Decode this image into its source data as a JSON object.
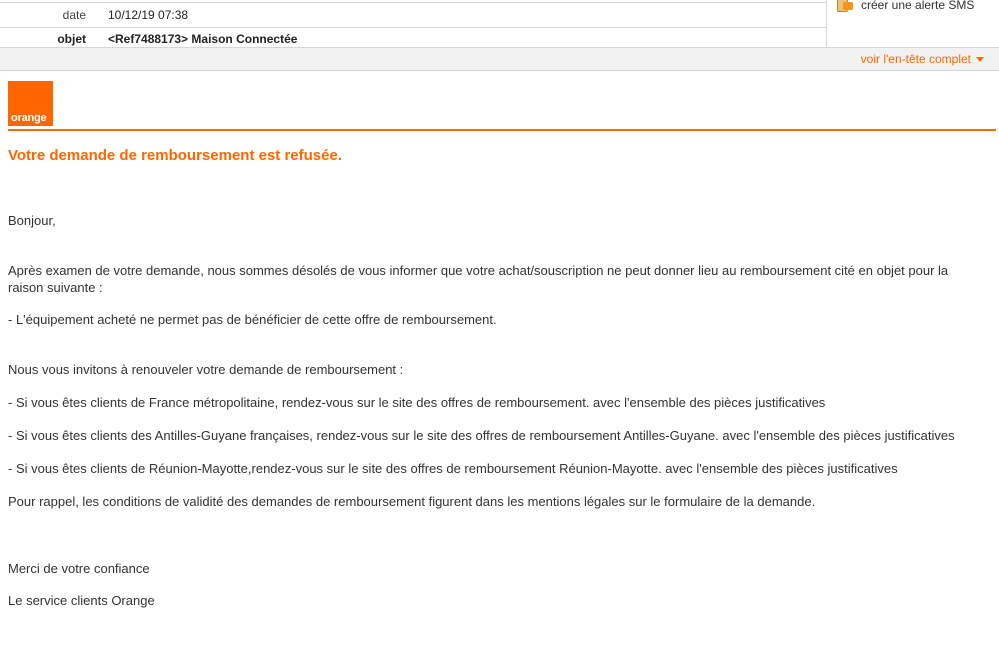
{
  "header": {
    "date_label": "date",
    "date_value": "10/12/19 07:38",
    "subject_label": "objet",
    "subject_value": "<Ref7488173> Maison Connectée",
    "sms_alert": "créer une alerte SMS",
    "full_header_link": "voir l'en-tête complet"
  },
  "brand": {
    "logo_text": "orange",
    "accent_color": "#ff6600"
  },
  "email": {
    "title": "Votre demande de remboursement est refusée.",
    "greeting": "Bonjour,",
    "para1": "Après examen de votre demande, nous sommes désolés de vous informer que votre achat/souscription ne peut donner lieu au remboursement cité en objet pour la raison suivante :",
    "reason": "- L'équipement acheté ne permet pas de bénéficier de cette offre de remboursement.",
    "invite": "Nous vous invitons à renouveler votre demande de remboursement :",
    "option1": "-  Si vous êtes clients de France métropolitaine, rendez-vous sur  le site des offres de remboursement. avec l'ensemble des pièces justificatives",
    "option2": "-  Si vous êtes clients des Antilles-Guyane françaises, rendez-vous sur  le site des offres de remboursement Antilles-Guyane. avec l'ensemble des pièces justificatives",
    "option3": "-  Si vous êtes clients de Réunion-Mayotte,rendez-vous sur  le site des offres de remboursement Réunion-Mayotte. avec l'ensemble des pièces justificatives",
    "reminder": "Pour rappel, les conditions de validité des demandes de remboursement figurent dans les mentions légales sur le formulaire de la demande.",
    "thanks": "Merci de votre confiance",
    "signature": "Le service clients Orange"
  }
}
